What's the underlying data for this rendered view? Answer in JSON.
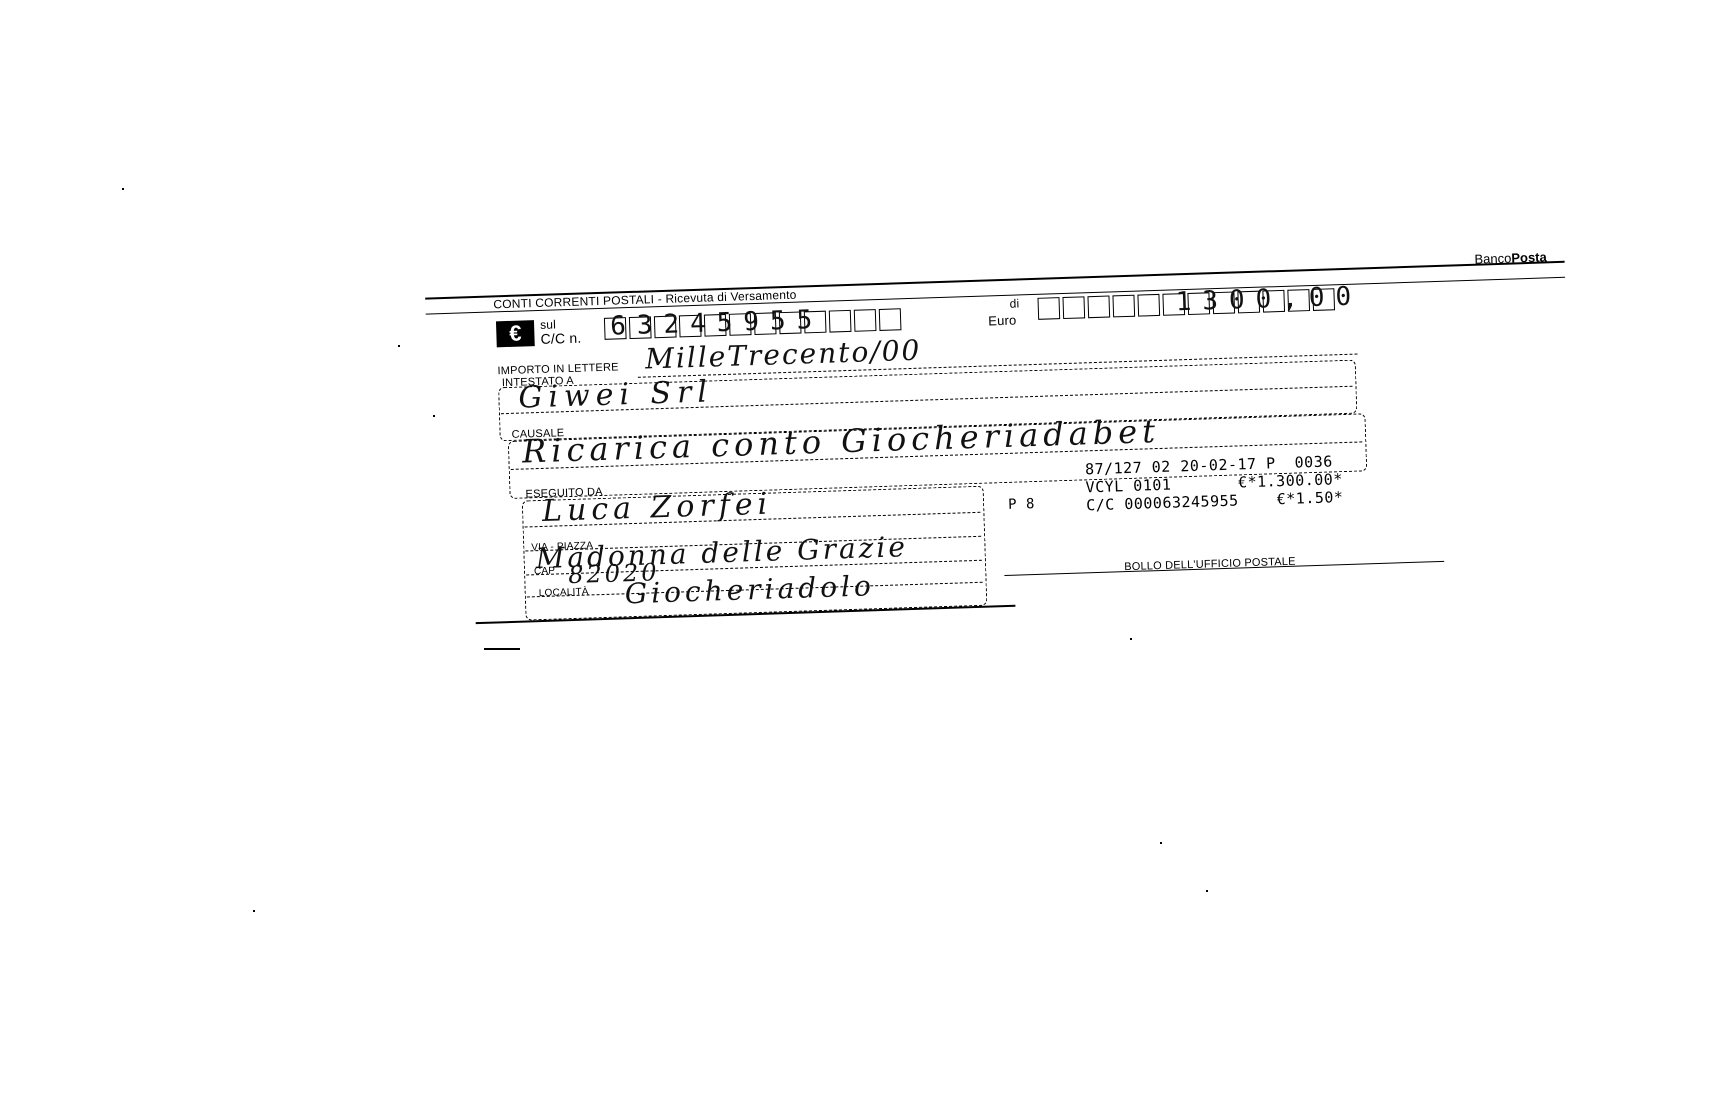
{
  "slip": {
    "header_title": "CONTI CORRENTI POSTALI - Ricevuta di Versamento",
    "brand": {
      "prefix": "Banco",
      "suffix": "Posta"
    },
    "currency_symbol": "€",
    "account_label_line1": "sul",
    "account_label_line2": "C/C n.",
    "account_number": "63245955",
    "amount_label_di": "di",
    "amount_label_euro": "Euro",
    "amount_value": "1300,00",
    "importo_label": "IMPORTO IN LETTERE",
    "importo_value": "MilleTrecento/00",
    "intestato_label": "INTESTATO A",
    "intestato_value": "Giwei Srl",
    "causale_label": "CAUSALE",
    "causale_value": "Ricarica conto Giocheriadabet",
    "eseguito_label": "ESEGUITO DA",
    "eseguito_value": "Luca Zorfei",
    "via_label": "VIA - PIAZZA",
    "via_value": "Madonna delle Grazie",
    "cap_label": "CAP",
    "cap_value": "82020",
    "localita_label": "LOCALITÀ",
    "localita_value": "Giocheriadolo",
    "p8_code": "P 8",
    "receipt_lines": [
      "87/127 02 20-02-17 P  0036",
      "VCYL 0101       €*1.300.00*",
      "C/C 000063245955    €*1.50*"
    ],
    "bollo_label": "BOLLO DELL'UFFICIO POSTALE"
  },
  "colors": {
    "ink": "#000000",
    "paper": "#ffffff"
  },
  "icons": {
    "euro": "euro-icon"
  }
}
